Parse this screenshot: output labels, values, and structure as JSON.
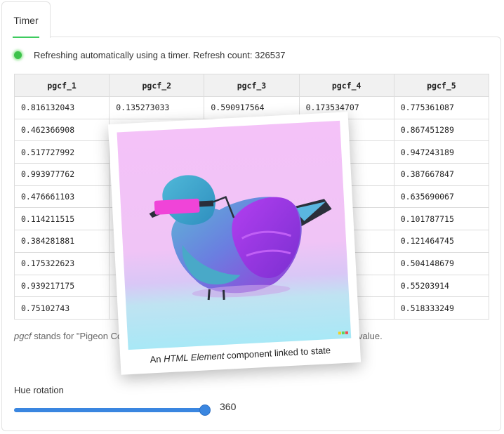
{
  "tab": {
    "label": "Timer"
  },
  "status": {
    "text": "Refreshing automatically using a timer. Refresh count: 326537",
    "color": "#3cc24a"
  },
  "table": {
    "columns": [
      "pgcf_1",
      "pgcf_2",
      "pgcf_3",
      "pgcf_4",
      "pgcf_5"
    ],
    "rows": [
      [
        "0.816132043",
        "0.135273033",
        "0.590917564",
        "0.173534707",
        "0.775361087"
      ],
      [
        "0.462366908",
        "",
        "",
        "",
        "0.867451289"
      ],
      [
        "0.517727992",
        "",
        "",
        "",
        "0.947243189"
      ],
      [
        "0.993977762",
        "",
        "",
        "",
        "0.387667847"
      ],
      [
        "0.476661103",
        "",
        "",
        "",
        "0.635690067"
      ],
      [
        "0.114211515",
        "",
        "",
        "",
        "0.101787715"
      ],
      [
        "0.384281881",
        "",
        "",
        "",
        "0.121464745"
      ],
      [
        "0.175322623",
        "",
        "",
        "",
        "0.504148679"
      ],
      [
        "0.939217175",
        "",
        "",
        "",
        "0.55203914"
      ],
      [
        "0.75102743",
        "",
        "",
        "",
        "0.518333249"
      ]
    ]
  },
  "caption": {
    "term": "pgcf",
    "rest": " stands for \"Pigeon Co",
    "end": "value."
  },
  "polaroid": {
    "caption_pre": "An ",
    "caption_em": "HTML Element",
    "caption_post": " component linked to state"
  },
  "hue": {
    "label": "Hue rotation",
    "value": "360",
    "fraction": 1.0,
    "accent": "#3a86e0"
  }
}
